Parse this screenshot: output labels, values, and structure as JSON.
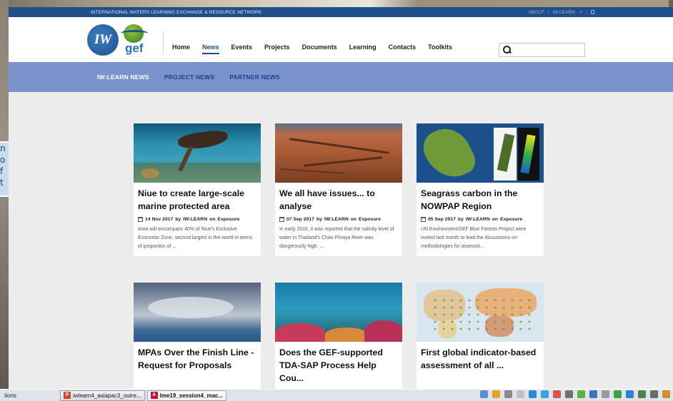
{
  "topstrip": {
    "network": "INTERNATIONAL WATERS LEARNING EXCHANGE & RESOURCE NETWORK",
    "about": "ABOUT",
    "sep": "|",
    "iwlearn": "IW:LEARN"
  },
  "logos": {
    "iw": "IW",
    "gef": "gef"
  },
  "nav": [
    "Home",
    "News",
    "Events",
    "Projects",
    "Documents",
    "Learning",
    "Contacts",
    "Toolkits"
  ],
  "nav_active": "News",
  "search": {
    "placeholder": "",
    "value": ""
  },
  "subnav": [
    "IW:LEARN NEWS",
    "PROJECT NEWS",
    "PARTNER NEWS"
  ],
  "bg_window_text": [
    "n",
    "o",
    "f",
    "t"
  ],
  "cards": [
    {
      "title": "Niue to create large-scale marine protected area",
      "date": "14 Nov 2017",
      "by": "by",
      "author": "IW:LEARN",
      "on": "on",
      "category": "Exposure",
      "excerpt": "Area will encompass 40% of Niue's Exclusive Economic Zone, second largest in the world in terms of proportion of ..."
    },
    {
      "title": "We all have issues... to analyse",
      "date": "07 Sep 2017",
      "by": "by",
      "author": "IW:LEARN",
      "on": "on",
      "category": "Exposure",
      "excerpt": "In early 2016, it was reported that the salinity level of water in Thailand's Chao Phraya River was dangerously high. ..."
    },
    {
      "title": "Seagrass carbon in the NOWPAP Region",
      "date": "05 Sep 2017",
      "by": "by",
      "author": "IW:LEARN",
      "on": "on",
      "category": "Exposure",
      "excerpt": "UN Environment/GEF Blue Forests Project were invited last month to lead the discussions on methodologies for assessin..."
    },
    {
      "title": "MPAs Over the Finish Line - Request for Proposals"
    },
    {
      "title": "Does the GEF-supported TDA-SAP Process Help Cou..."
    },
    {
      "title": "First global indicator-based assessment of all ..."
    }
  ],
  "taskbar": {
    "left": "tions",
    "tasks": [
      {
        "icon": "P",
        "label": "iwlearn4_asiapac3_outre..."
      },
      {
        "icon": "A",
        "label": "lme19_session4_mac..."
      }
    ]
  }
}
